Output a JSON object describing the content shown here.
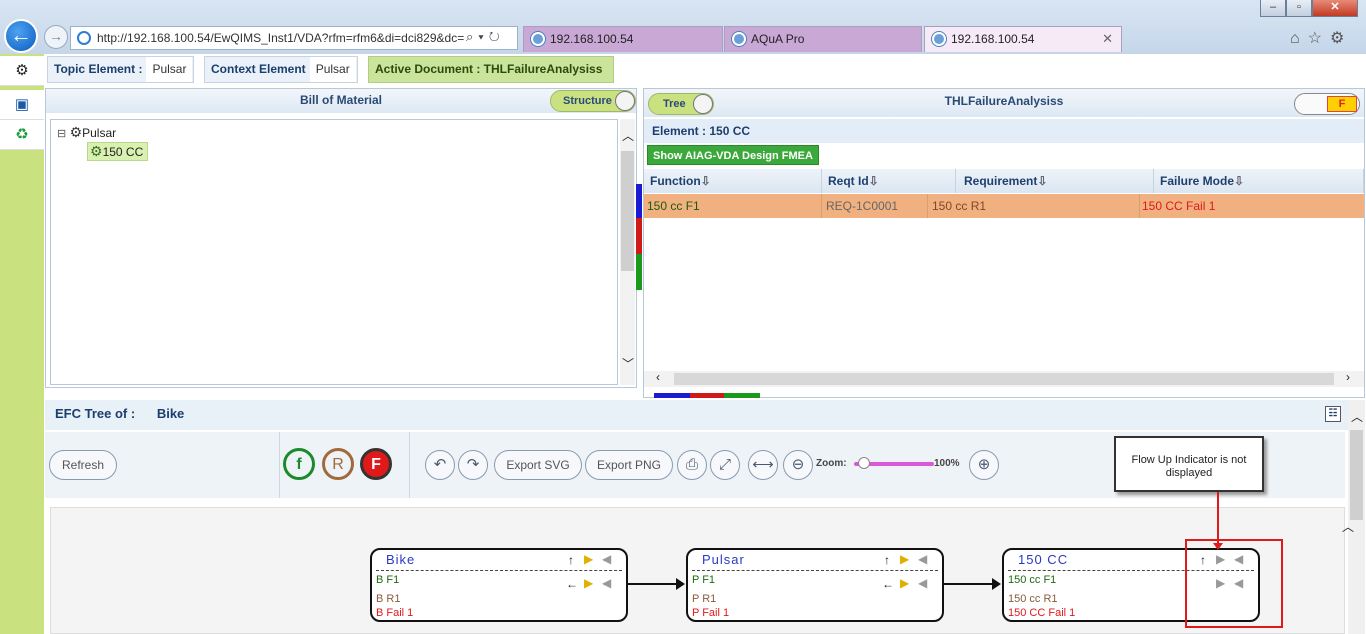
{
  "browser": {
    "address": "http://192.168.100.54/EwQIMS_Inst1/VDA?rfm=rfm6&di=dci829&dc=",
    "address_host": "192.168.100.54",
    "tabs": [
      {
        "label": "192.168.100.54"
      },
      {
        "label": "AQuA Pro"
      },
      {
        "label": "192.168.100.54"
      }
    ]
  },
  "topic": {
    "topic_label": "Topic Element :",
    "topic_value": "Pulsar",
    "context_label": "Context Element",
    "context_value": "Pulsar",
    "active_doc": "Active Document : THLFailureAnalysiss"
  },
  "bom": {
    "title": "Bill of Material",
    "toggle_label": "Structure",
    "tree": [
      {
        "label": "Pulsar"
      },
      {
        "label": "150 CC"
      }
    ]
  },
  "fmea": {
    "title": "THLFailureAnalysiss",
    "toggle_label": "Tree",
    "f_label": "F",
    "element": "Element : 150 CC",
    "design_button": "Show AIAG-VDA Design FMEA",
    "columns": [
      "Function",
      "Reqt Id",
      "Requirement",
      "Failure Mode"
    ],
    "rows": [
      {
        "function": "150 cc F1",
        "reqt_id": "REQ-1C0001",
        "requirement": "150 cc R1",
        "failure_mode": "150 CC Fail 1"
      }
    ]
  },
  "efc": {
    "label": "EFC Tree of :",
    "value": "Bike",
    "toolbar": {
      "refresh": "Refresh",
      "f": "f",
      "r": "R",
      "fail": "F",
      "export_svg": "Export SVG",
      "export_png": "Export PNG",
      "zoom_label": "Zoom:",
      "zoom_value": "100%"
    },
    "callout": "Flow Up Indicator is not displayed",
    "nodes": [
      {
        "title": "Bike",
        "f": "B F1",
        "r": "B R1",
        "fail": "B Fail 1"
      },
      {
        "title": "Pulsar",
        "f": "P F1",
        "r": "P R1",
        "fail": "P Fail 1"
      },
      {
        "title": "150  CC",
        "f": "150 cc F1",
        "r": "150 cc R1",
        "fail": "150 CC Fail 1"
      }
    ]
  },
  "colors": {
    "accent_green": "#c9e17e",
    "row_highlight": "#f0b080",
    "failure_red": "#e0191b",
    "node_title_blue": "#2b37c8"
  }
}
